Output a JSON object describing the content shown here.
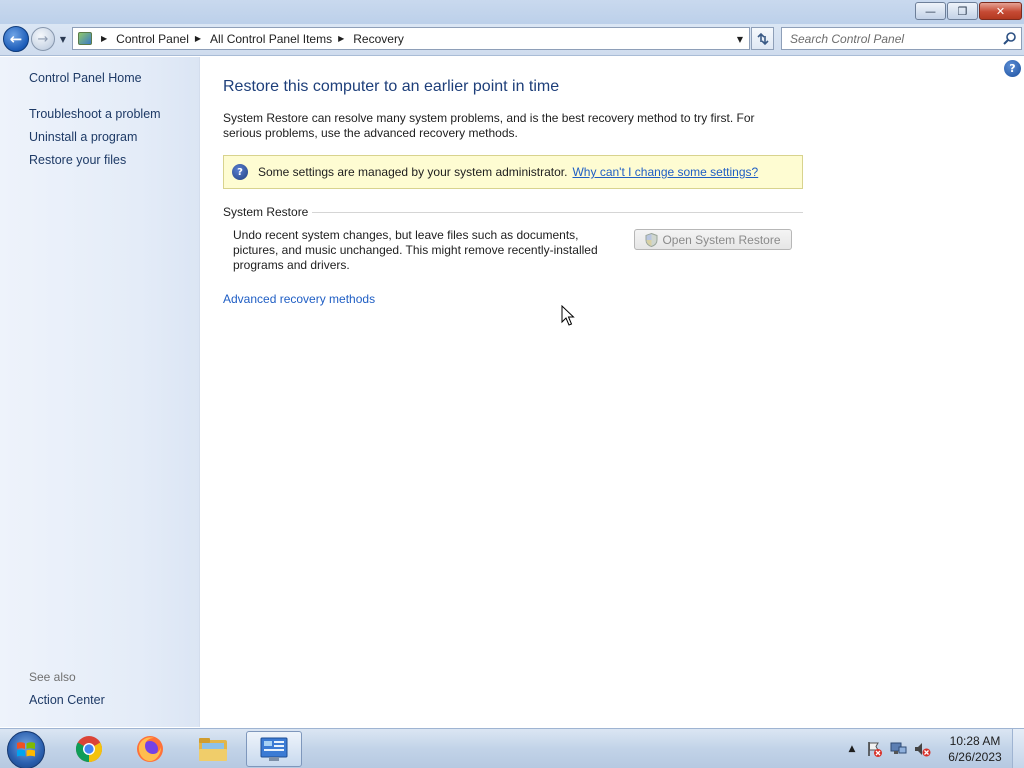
{
  "window": {
    "minimize_glyph": "—",
    "restore_glyph": "❐",
    "close_glyph": "✕"
  },
  "navbar": {
    "back_glyph": "←",
    "forward_glyph": "→",
    "breadcrumbs": [
      "Control Panel",
      "All Control Panel Items",
      "Recovery"
    ],
    "search_placeholder": "Search Control Panel"
  },
  "sidebar": {
    "home": "Control Panel Home",
    "items": [
      {
        "label": "Troubleshoot a problem"
      },
      {
        "label": "Uninstall a program"
      },
      {
        "label": "Restore your files"
      }
    ],
    "see_also_title": "See also",
    "see_also_items": [
      {
        "label": "Action Center"
      }
    ]
  },
  "main": {
    "title": "Restore this computer to an earlier point in time",
    "intro": "System Restore can resolve many system problems, and is the best recovery method to try first. For serious problems, use the advanced recovery methods.",
    "info_text": "Some settings are managed by your system administrator.",
    "info_link": "Why can't I change some settings?",
    "section_title": "System Restore",
    "section_desc": "Undo recent system changes, but leave files such as documents, pictures, and music unchanged. This might remove recently-installed programs and drivers.",
    "button_label": "Open System Restore",
    "button_enabled": false,
    "advanced_link": "Advanced recovery methods"
  },
  "taskbar": {
    "apps": [
      "start-menu",
      "chrome",
      "firefox",
      "file-explorer",
      "control-panel"
    ],
    "active_app": "control-panel",
    "time": "10:28 AM",
    "date": "6/26/2023"
  },
  "colors": {
    "title_blue": "#1e3f7a",
    "link_blue": "#1f5ec4",
    "info_bg": "#fefcd2",
    "sidebar_bg": "#e4ecf8"
  }
}
